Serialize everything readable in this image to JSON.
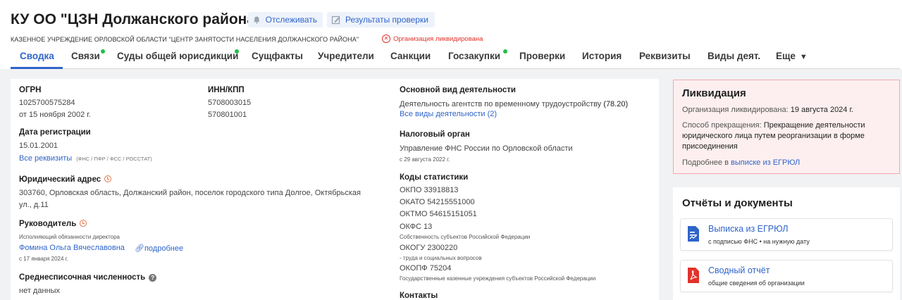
{
  "header": {
    "title": "КУ ОО \"ЦЗН Должанского района\"",
    "track_label": "Отслеживать",
    "results_label": "Результаты проверки",
    "full_name": "КАЗЕННОЕ УЧРЕЖДЕНИЕ ОРЛОВСКОЙ ОБЛАСТИ \"ЦЕНТР ЗАНЯТОСТИ НАСЕЛЕНИЯ ДОЛЖАНСКОГО РАЙОНА\"",
    "status_badge": "Организация ликвидирована"
  },
  "tabs": [
    {
      "label": "Сводка",
      "active": true
    },
    {
      "label": "Связи",
      "dot": true
    },
    {
      "label": "Суды общей юрисдикции",
      "dot": true
    },
    {
      "label": "Сущфакты"
    },
    {
      "label": "Учредители"
    },
    {
      "label": "Санкции"
    },
    {
      "label": "Госзакупки",
      "dot": true
    },
    {
      "label": "Проверки"
    },
    {
      "label": "История"
    },
    {
      "label": "Реквизиты"
    },
    {
      "label": "Виды деят."
    },
    {
      "label": "Еще"
    }
  ],
  "main": {
    "ogrn_label": "ОГРН",
    "ogrn_value": "1025700575284",
    "ogrn_date": "от 15 ноября 2002 г.",
    "inn_label": "ИНН/КПП",
    "inn_value": "5708003015",
    "kpp_value": "570801001",
    "reg_label": "Дата регистрации",
    "reg_value": "15.01.2001",
    "all_requisites": "Все реквизиты",
    "requisites_sources": "(ФНС / ПФР / ФСС / РОССТАТ)",
    "address_label": "Юридический адрес",
    "address_line1": "303760, Орловская область, Должанский район, поселок городского типа Долгое, Октябрьская",
    "address_line2": "ул., д.11",
    "head_label": "Руководитель",
    "head_role": "Исполняющий обязанности директора",
    "head_name": "Фомина Ольга Вячеславовна",
    "head_more": "подробнее",
    "head_since": "с 17 января 2024 г.",
    "staff_label": "Среднесписочная численность",
    "staff_value": "нет данных",
    "activity_label": "Основной вид деятельности",
    "activity_value": "Деятельность агентств по временному трудоустройству",
    "activity_code": "(78.20)",
    "all_activities": "Все виды деятельности (2)",
    "tax_label": "Налоговый орган",
    "tax_value": "Управление ФНС России по Орловской области",
    "tax_since": "с 29 августа 2022 г.",
    "codes_label": "Коды статистики",
    "okpo": "ОКПО   33918813",
    "okato": "ОКАТО   54215551000",
    "oktmo": "ОКТМО   54615151051",
    "okfs": "ОКФС    13",
    "okfs_desc": "Собственность субъектов Российской Федерации",
    "okogu": "ОКОГУ   2300220",
    "okogu_desc": "- труда и социальных вопросов",
    "okopf": "ОКОПФ  75204",
    "okopf_desc": "Государственные казенные учреждения субъектов Российской Федерации",
    "contacts_label": "Контакты"
  },
  "liquidation": {
    "title": "Ликвидация",
    "date_label": "Организация ликвидирована:",
    "date_value": "19 августа 2024 г.",
    "method_label": "Способ прекращения:",
    "method_value_1": "Прекращение деятельности",
    "method_value_2": "юридического лица путем реорганизации в форме",
    "method_value_3": "присоединения",
    "more_prefix": "Подробнее в",
    "more_link": "выписке из ЕГРЮЛ"
  },
  "docs": {
    "title": "Отчёты и документы",
    "items": [
      {
        "title": "Выписка из ЕГРЮЛ",
        "sub": "с подписью ФНС • на нужную дату"
      },
      {
        "title": "Сводный отчёт",
        "sub": "общие сведения об организации"
      }
    ]
  },
  "colors": {
    "accent": "#2f64c9",
    "danger": "#e0322b",
    "online_dot": "#1fbf4a"
  }
}
